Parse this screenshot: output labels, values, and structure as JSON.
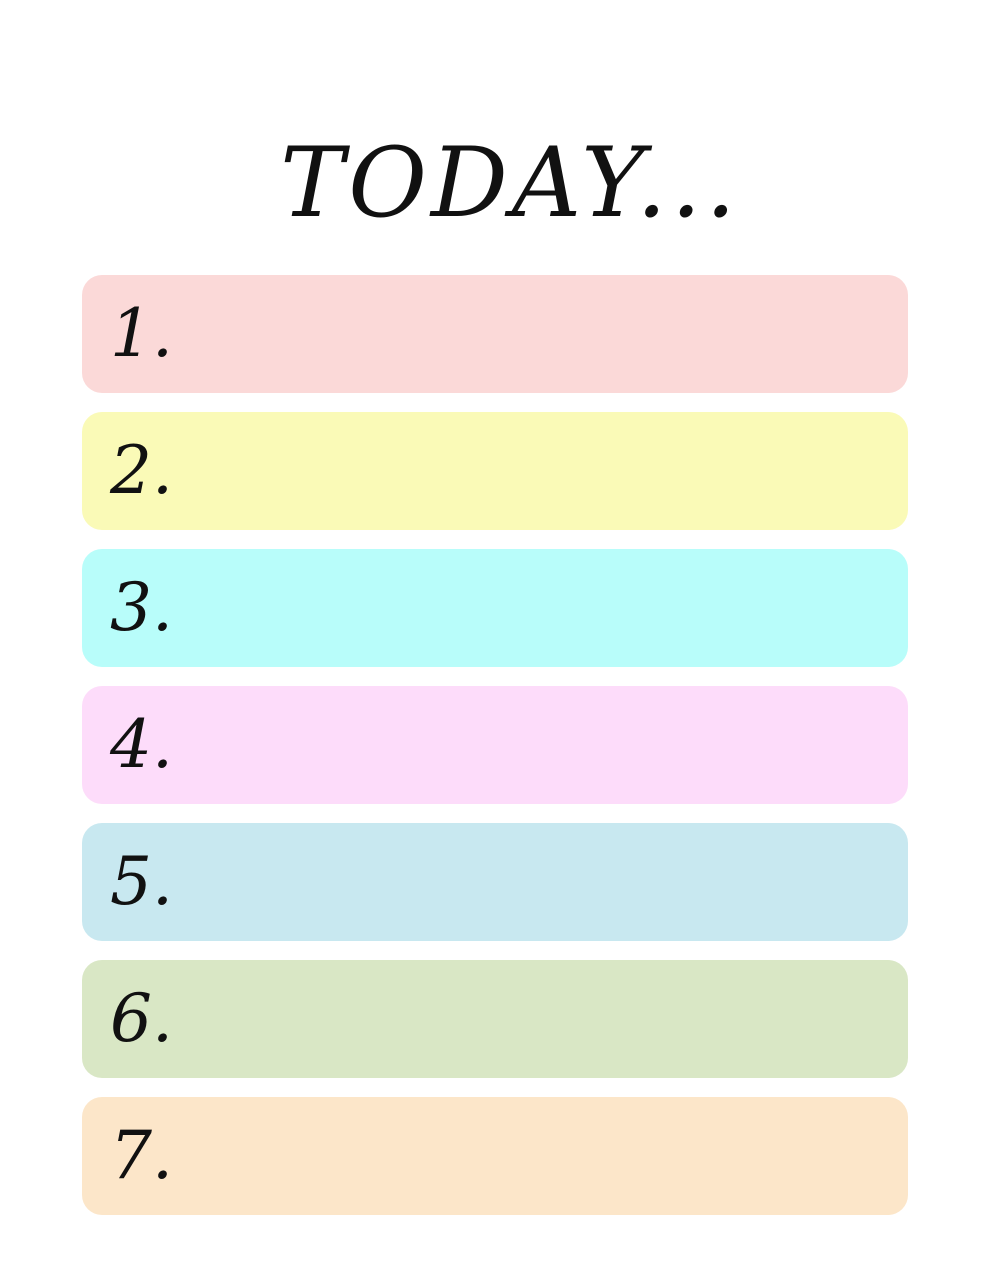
{
  "title": "TODAY...",
  "items": [
    {
      "number": "1.",
      "color": "#fbd9d8"
    },
    {
      "number": "2.",
      "color": "#fafab7"
    },
    {
      "number": "3.",
      "color": "#b8fdfa"
    },
    {
      "number": "4.",
      "color": "#fddcfa"
    },
    {
      "number": "5.",
      "color": "#c8e8f0"
    },
    {
      "number": "6.",
      "color": "#d9e7c5"
    },
    {
      "number": "7.",
      "color": "#fce6c9"
    }
  ]
}
